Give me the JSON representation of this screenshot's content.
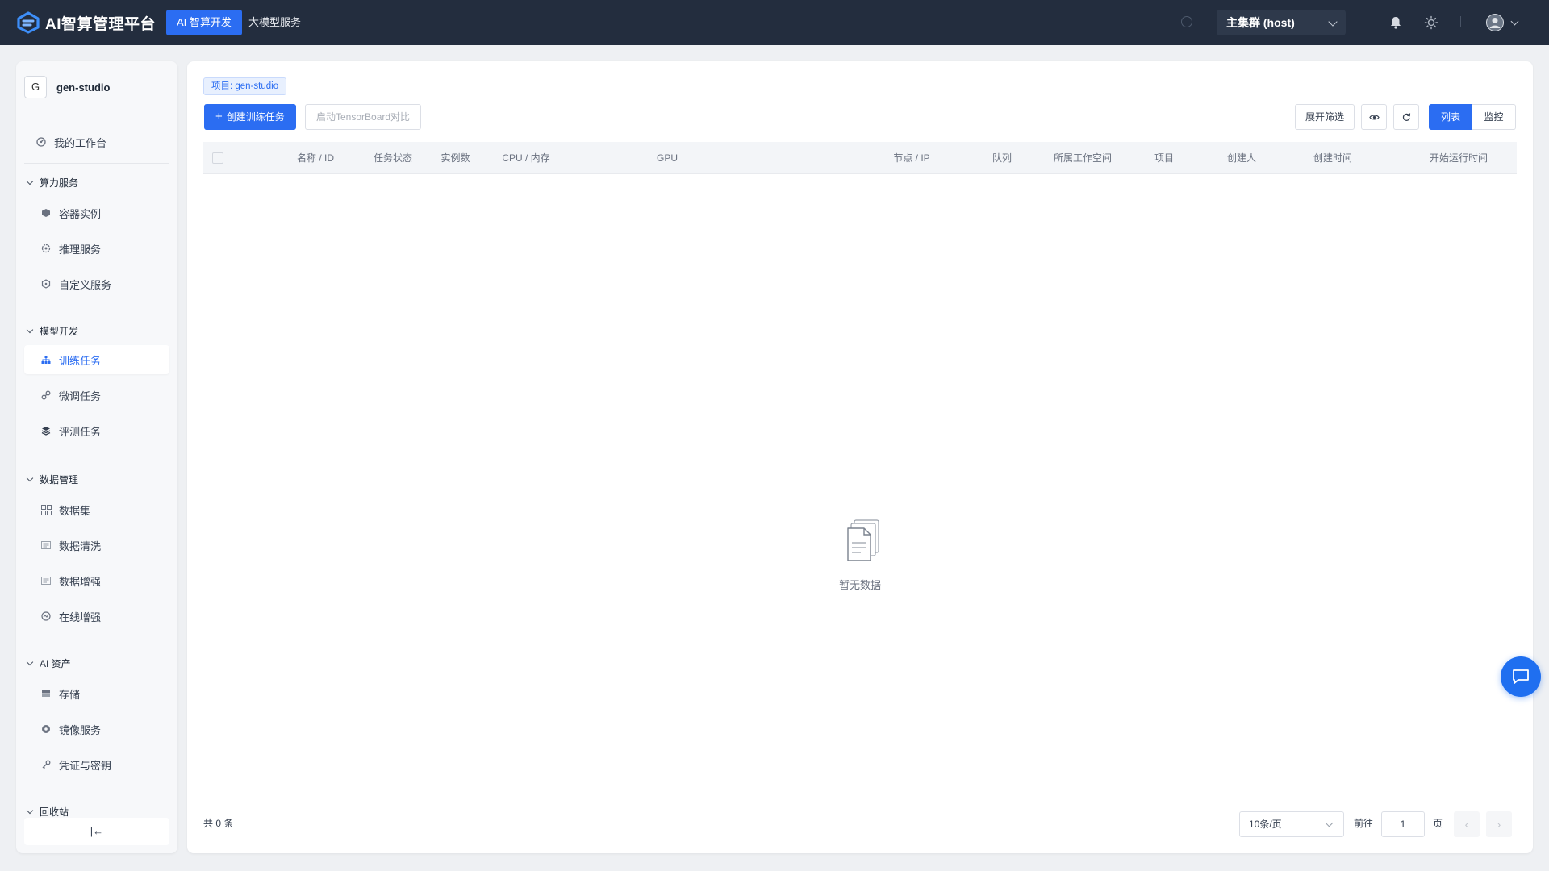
{
  "app": {
    "title": "AI智算管理平台"
  },
  "nav": {
    "tabs": [
      {
        "label": "AI 智算开发"
      },
      {
        "label": "大模型服务"
      }
    ]
  },
  "header": {
    "cluster": "主集群 (host)"
  },
  "sidebar": {
    "project_initial": "G",
    "project_name": "gen-studio",
    "workbench": "我的工作台",
    "groups": [
      {
        "label": "算力服务",
        "items": [
          {
            "label": "容器实例"
          },
          {
            "label": "推理服务"
          },
          {
            "label": "自定义服务"
          }
        ]
      },
      {
        "label": "模型开发",
        "items": [
          {
            "label": "训练任务"
          },
          {
            "label": "微调任务"
          },
          {
            "label": "评测任务"
          }
        ]
      },
      {
        "label": "数据管理",
        "items": [
          {
            "label": "数据集"
          },
          {
            "label": "数据清洗"
          },
          {
            "label": "数据增强"
          },
          {
            "label": "在线增强"
          }
        ]
      },
      {
        "label": "AI 资产",
        "items": [
          {
            "label": "存储"
          },
          {
            "label": "镜像服务"
          },
          {
            "label": "凭证与密钥"
          }
        ]
      },
      {
        "label": "回收站",
        "items": []
      }
    ],
    "active_item": "训练任务",
    "collapse_glyph": "|←"
  },
  "main": {
    "project_tag": "项目: gen-studio",
    "create_button": "创建训练任务",
    "tensorboard_button": "启动TensorBoard对比",
    "filter_button": "展开筛选",
    "view_list": "列表",
    "view_monitor": "监控",
    "columns": [
      "名称 / ID",
      "任务状态",
      "实例数",
      "CPU / 内存",
      "GPU",
      "节点 / IP",
      "队列",
      "所属工作空间",
      "项目",
      "创建人",
      "创建时间",
      "开始运行时间"
    ],
    "empty_text": "暂无数据",
    "total": "共 0 条",
    "page_size": "10条/页",
    "goto_label": "前往",
    "page_value": "1",
    "page_unit": "页"
  },
  "colors": {
    "accent": "#2b6df2",
    "topbar": "#232d3e",
    "sidebar_bg": "#f7f8fa",
    "page_bg": "#eef0f3"
  }
}
